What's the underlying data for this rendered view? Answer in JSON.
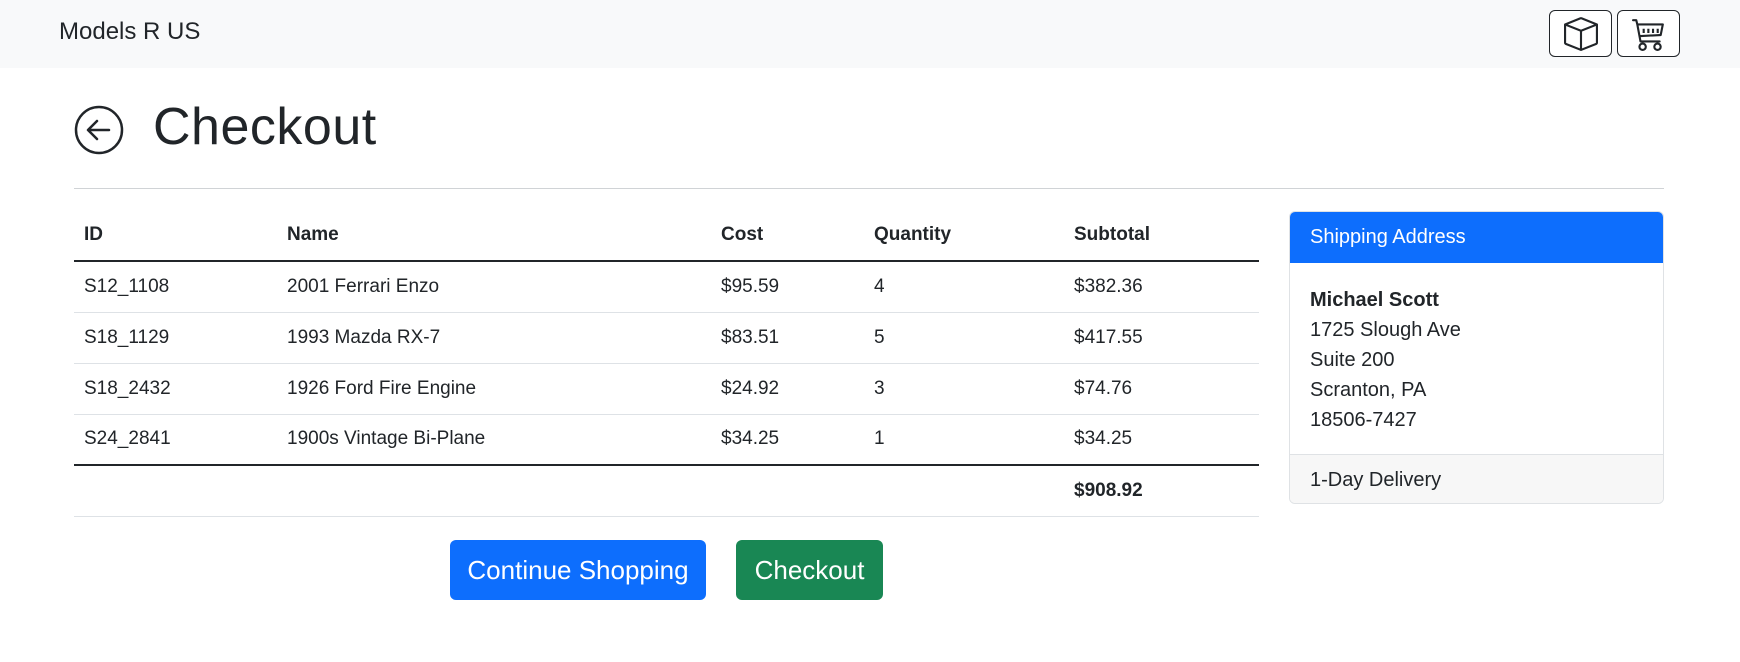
{
  "navbar": {
    "brand": "Models R US",
    "icons": [
      "box-icon",
      "cart-icon"
    ]
  },
  "header": {
    "back_icon": "arrow-left-circle-icon",
    "title": "Checkout"
  },
  "table": {
    "columns": [
      "ID",
      "Name",
      "Cost",
      "Quantity",
      "Subtotal"
    ],
    "rows": [
      {
        "id": "S12_1108",
        "name": "2001 Ferrari Enzo",
        "cost": "$95.59",
        "quantity": "4",
        "subtotal": "$382.36"
      },
      {
        "id": "S18_1129",
        "name": "1993 Mazda RX-7",
        "cost": "$83.51",
        "quantity": "5",
        "subtotal": "$417.55"
      },
      {
        "id": "S18_2432",
        "name": "1926 Ford Fire Engine",
        "cost": "$24.92",
        "quantity": "3",
        "subtotal": "$74.76"
      },
      {
        "id": "S24_2841",
        "name": "1900s Vintage Bi-Plane",
        "cost": "$34.25",
        "quantity": "1",
        "subtotal": "$34.25"
      }
    ],
    "total": "$908.92"
  },
  "buttons": {
    "continue_label": "Continue Shopping",
    "checkout_label": "Checkout"
  },
  "shipping": {
    "header": "Shipping Address",
    "name": "Michael Scott",
    "address_lines": [
      "1725 Slough Ave",
      "Suite 200",
      "Scranton, PA",
      "18506-7427"
    ],
    "delivery": "1-Day Delivery"
  },
  "colors": {
    "primary": "#0d6efd",
    "success": "#198754",
    "navbar_bg": "#f8f9fa"
  }
}
